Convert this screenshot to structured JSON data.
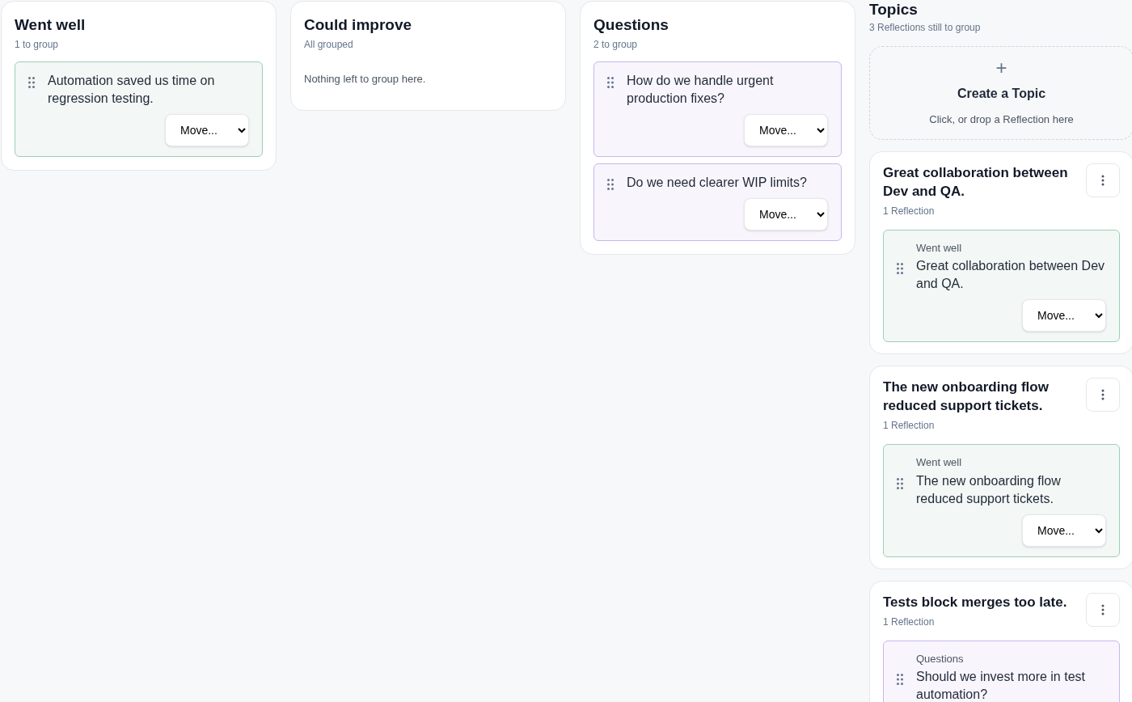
{
  "columns": [
    {
      "title": "Went well",
      "subtitle": "1 to group",
      "reflections": [
        {
          "kind": "went_well",
          "text": "Automation saved us time on regression testing.",
          "move": "Move..."
        }
      ]
    },
    {
      "title": "Could improve",
      "subtitle": "All grouped",
      "empty_text": "Nothing left to group here."
    },
    {
      "title": "Questions",
      "subtitle": "2 to group",
      "reflections": [
        {
          "kind": "questions",
          "text": "How do we handle urgent production fixes?",
          "move": "Move..."
        },
        {
          "kind": "questions",
          "text": "Do we need clearer WIP limits?",
          "move": "Move..."
        }
      ]
    }
  ],
  "topics": {
    "title": "Topics",
    "subtitle": "3 Reflections still to group",
    "create": {
      "icon": "+",
      "title": "Create a Topic",
      "hint": "Click, or drop a Reflection here"
    },
    "items": [
      {
        "title": "Great collaboration between Dev and QA.",
        "count": "1 Reflection",
        "reflections": [
          {
            "kind": "went_well",
            "source": "Went well",
            "text": "Great collaboration between Dev and QA.",
            "move": "Move..."
          }
        ]
      },
      {
        "title": "The new onboarding flow reduced support tickets.",
        "count": "1 Reflection",
        "reflections": [
          {
            "kind": "went_well",
            "source": "Went well",
            "text": "The new onboarding flow reduced support tickets.",
            "move": "Move..."
          }
        ]
      },
      {
        "title": "Tests block merges too late.",
        "count": "1 Reflection",
        "reflections": [
          {
            "kind": "questions",
            "source": "Questions",
            "text": "Should we invest more in test automation?"
          }
        ]
      }
    ]
  }
}
